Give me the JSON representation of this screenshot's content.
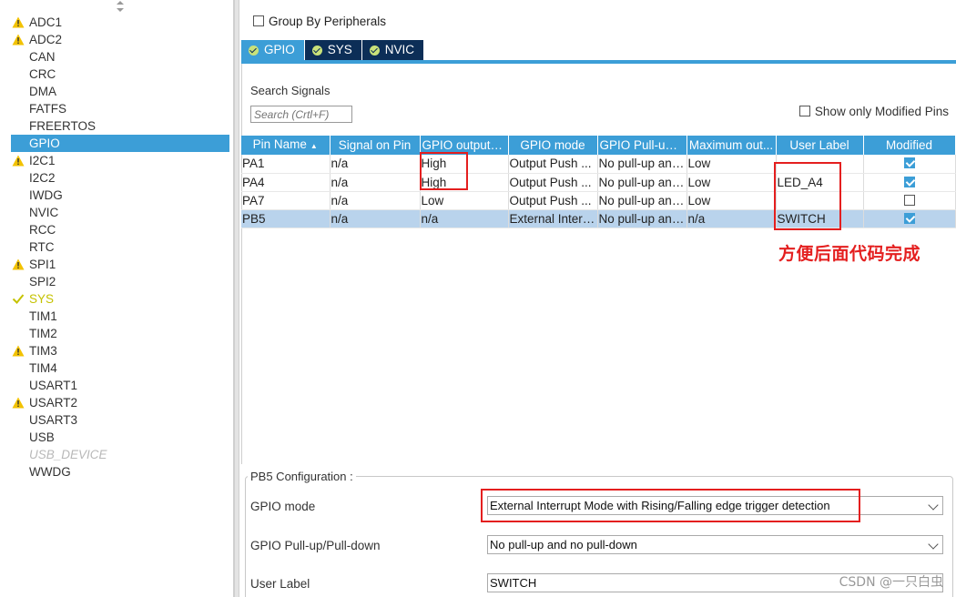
{
  "categories": [
    {
      "label": "ADC1",
      "status": "warning"
    },
    {
      "label": "ADC2",
      "status": "warning"
    },
    {
      "label": "CAN",
      "status": "none"
    },
    {
      "label": "CRC",
      "status": "none"
    },
    {
      "label": "DMA",
      "status": "none"
    },
    {
      "label": "FATFS",
      "status": "none"
    },
    {
      "label": "FREERTOS",
      "status": "none"
    },
    {
      "label": "GPIO",
      "status": "selected"
    },
    {
      "label": "I2C1",
      "status": "warning"
    },
    {
      "label": "I2C2",
      "status": "none"
    },
    {
      "label": "IWDG",
      "status": "none"
    },
    {
      "label": "NVIC",
      "status": "none"
    },
    {
      "label": "RCC",
      "status": "none"
    },
    {
      "label": "RTC",
      "status": "none"
    },
    {
      "label": "SPI1",
      "status": "warning"
    },
    {
      "label": "SPI2",
      "status": "none"
    },
    {
      "label": "SYS",
      "status": "ok"
    },
    {
      "label": "TIM1",
      "status": "none"
    },
    {
      "label": "TIM2",
      "status": "none"
    },
    {
      "label": "TIM3",
      "status": "warning"
    },
    {
      "label": "TIM4",
      "status": "none"
    },
    {
      "label": "USART1",
      "status": "none"
    },
    {
      "label": "USART2",
      "status": "warning"
    },
    {
      "label": "USART3",
      "status": "none"
    },
    {
      "label": "USB",
      "status": "none"
    },
    {
      "label": "USB_DEVICE",
      "status": "disabled"
    },
    {
      "label": "WWDG",
      "status": "none"
    }
  ],
  "group_by": {
    "label": "Group By Peripherals",
    "checked": false
  },
  "tabs": [
    {
      "label": "GPIO",
      "active": true
    },
    {
      "label": "SYS",
      "active": false
    },
    {
      "label": "NVIC",
      "active": false
    }
  ],
  "search": {
    "title": "Search Signals",
    "placeholder": "Search (Crtl+F)"
  },
  "show_modified": {
    "label": "Show only Modified Pins",
    "checked": false
  },
  "table": {
    "columns": [
      "Pin Name",
      "Signal on Pin",
      "GPIO output l...",
      "GPIO mode",
      "GPIO Pull-up/...",
      "Maximum out...",
      "User Label",
      "Modified"
    ],
    "rows": [
      {
        "pin": "PA1",
        "signal": "n/a",
        "output": "High",
        "mode": "Output Push ...",
        "pull": "No pull-up and...",
        "speed": "Low",
        "label": "",
        "modified": true,
        "selected": false
      },
      {
        "pin": "PA4",
        "signal": "n/a",
        "output": "High",
        "mode": "Output Push ...",
        "pull": "No pull-up and...",
        "speed": "Low",
        "label": "LED_A4",
        "modified": true,
        "selected": false
      },
      {
        "pin": "PA7",
        "signal": "n/a",
        "output": "Low",
        "mode": "Output Push ...",
        "pull": "No pull-up and...",
        "speed": "Low",
        "label": "",
        "modified": false,
        "selected": false
      },
      {
        "pin": "PB5",
        "signal": "n/a",
        "output": "n/a",
        "mode": "External Interr...",
        "pull": "No pull-up and...",
        "speed": "n/a",
        "label": "SWITCH",
        "modified": true,
        "selected": true
      }
    ]
  },
  "annotation": "方便后面代码完成",
  "config": {
    "title": "PB5 Configuration :",
    "gpio_mode_label": "GPIO mode",
    "gpio_mode_value": "External Interrupt Mode with Rising/Falling edge trigger detection",
    "pull_label": "GPIO Pull-up/Pull-down",
    "pull_value": "No pull-up and no pull-down",
    "user_label_label": "User Label",
    "user_label_value": "SWITCH"
  },
  "watermark": "CSDN @一只白虫",
  "colors": {
    "accent": "#3c9ed7",
    "tab_dark": "#0c2e57",
    "warning": "#f2c200",
    "ok": "#c5c200",
    "annotation": "#e41f1f"
  }
}
